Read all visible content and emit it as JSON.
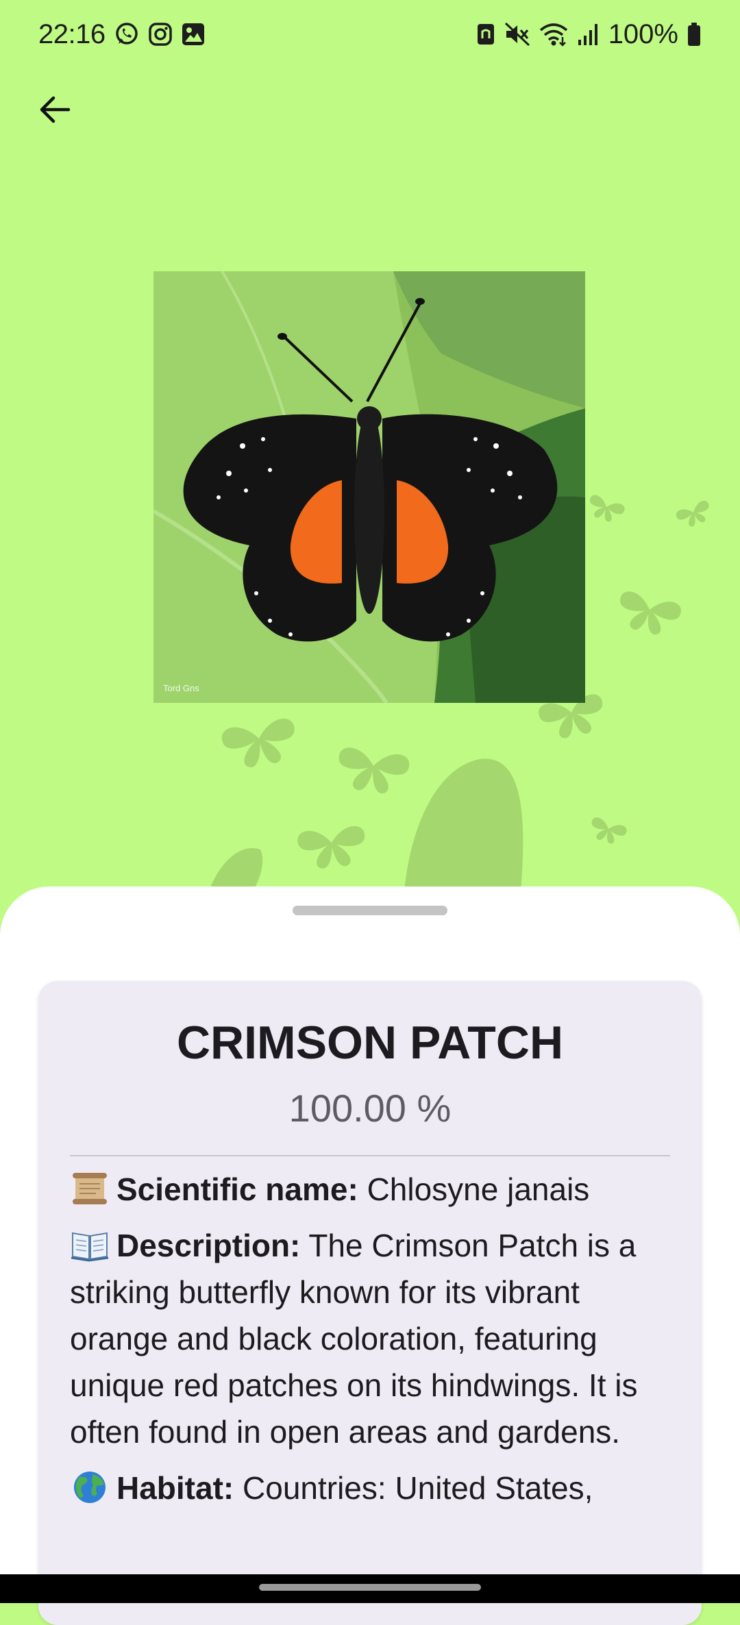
{
  "status_bar": {
    "time": "22:16",
    "battery": "100%",
    "left_icons": [
      "whatsapp-icon",
      "instagram-icon",
      "gallery-icon"
    ],
    "right_icons": [
      "nfc-icon",
      "mute-icon",
      "wifi-icon",
      "signal-icon",
      "battery-icon"
    ]
  },
  "header": {
    "back_icon": "arrow-left-icon"
  },
  "colors": {
    "background": "#bffb84",
    "silhouette": "#a4d86f",
    "sheet": "#ffffff",
    "card": "#efebf4",
    "wing_orange": "#f26a1b"
  },
  "result": {
    "name": "CRIMSON PATCH",
    "confidence": "100.00 %",
    "photo_watermark": "Tord Gns",
    "scientific_label": "Scientific name:",
    "scientific_value": "Chlosyne janais",
    "description_label": "Description:",
    "description_value": "The Crimson Patch is a striking butterfly known for its vibrant orange and black coloration, featuring unique red patches on its hindwings. It is often found in open areas and gardens.",
    "habitat_label": "Habitat:",
    "habitat_value": "Countries: United States,",
    "icons": [
      "scroll-icon",
      "book-icon",
      "globe-icon"
    ]
  }
}
